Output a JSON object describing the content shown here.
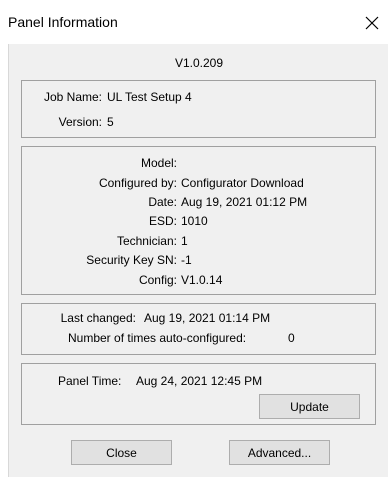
{
  "window": {
    "title": "Panel Information"
  },
  "version": "V1.0.209",
  "job": {
    "name_label": "Job Name:",
    "name_value": "UL Test Setup 4",
    "version_label": "Version:",
    "version_value": "5"
  },
  "details": [
    {
      "label": "Model:",
      "value": ""
    },
    {
      "label": "Configured by:",
      "value": "Configurator Download"
    },
    {
      "label": "Date:",
      "value": "Aug 19, 2021  01:12 PM"
    },
    {
      "label": "ESD:",
      "value": "1010"
    },
    {
      "label": "Technician:",
      "value": "1"
    },
    {
      "label": "Security Key SN:",
      "value": "-1"
    },
    {
      "label": "Config:",
      "value": "V1.0.14"
    }
  ],
  "changes": {
    "last_changed_label": "Last changed:",
    "last_changed_value": "Aug 19, 2021  01:14 PM",
    "autoconfig_label": "Number of times auto-configured:",
    "autoconfig_value": "0"
  },
  "panel_time": {
    "label": "Panel Time:",
    "value": "Aug 24, 2021  12:45 PM",
    "update_button": "Update"
  },
  "buttons": {
    "close": "Close",
    "advanced": "Advanced..."
  }
}
